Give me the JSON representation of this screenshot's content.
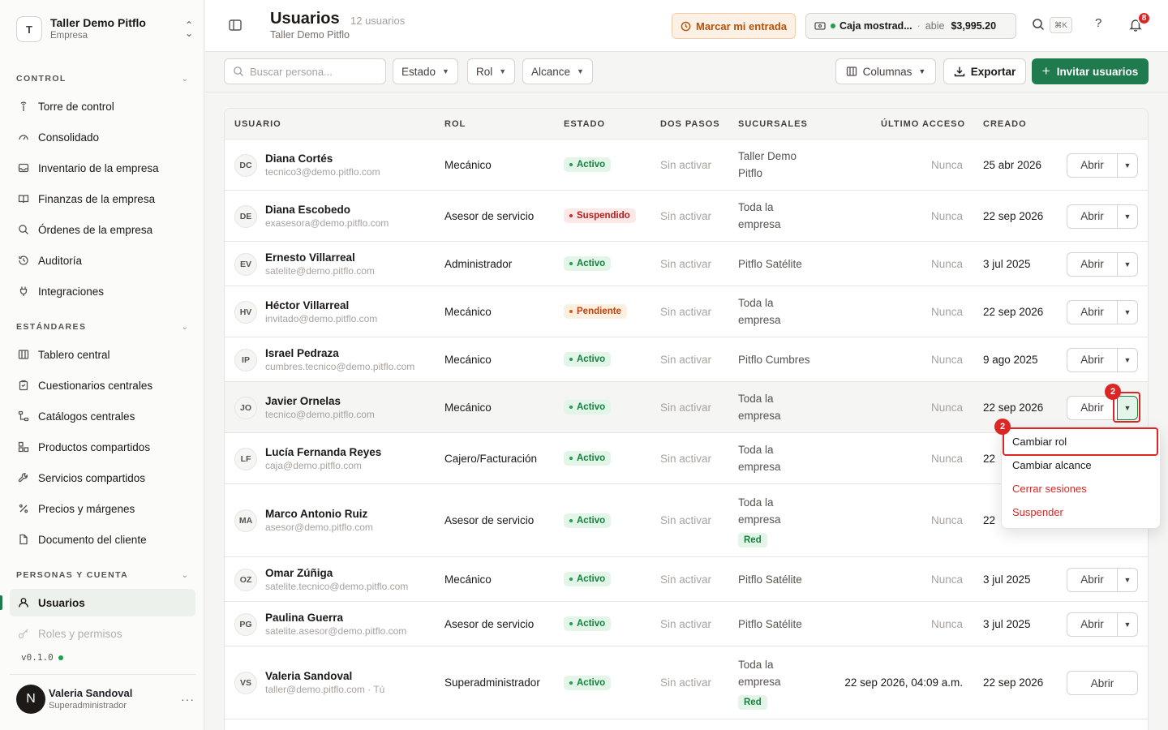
{
  "company": {
    "initial": "T",
    "name": "Taller Demo Pitflo",
    "type": "Empresa"
  },
  "sidebar": {
    "sections": [
      {
        "title": "CONTROL",
        "items": [
          {
            "label": "Torre de control",
            "icon": "tower-icon"
          },
          {
            "label": "Consolidado",
            "icon": "gauge-icon"
          },
          {
            "label": "Inventario de la empresa",
            "icon": "inbox-icon"
          },
          {
            "label": "Finanzas de la empresa",
            "icon": "book-icon"
          },
          {
            "label": "Órdenes de la empresa",
            "icon": "search-icon"
          },
          {
            "label": "Auditoría",
            "icon": "history-icon"
          },
          {
            "label": "Integraciones",
            "icon": "plug-icon"
          }
        ]
      },
      {
        "title": "ESTÁNDARES",
        "items": [
          {
            "label": "Tablero central",
            "icon": "columns-icon"
          },
          {
            "label": "Cuestionarios centrales",
            "icon": "clipboard-icon"
          },
          {
            "label": "Catálogos centrales",
            "icon": "tree-icon"
          },
          {
            "label": "Productos compartidos",
            "icon": "boxes-icon"
          },
          {
            "label": "Servicios compartidos",
            "icon": "wrench-icon"
          },
          {
            "label": "Precios y márgenes",
            "icon": "percent-icon"
          },
          {
            "label": "Documento del cliente",
            "icon": "document-icon"
          }
        ]
      },
      {
        "title": "PERSONAS Y CUENTA",
        "items": [
          {
            "label": "Usuarios",
            "icon": "user-icon"
          },
          {
            "label": "Roles y permisos",
            "icon": "key-icon"
          }
        ]
      }
    ],
    "version": "v0.1.0",
    "user": {
      "initial": "N",
      "name": "Valeria Sandoval",
      "role": "Superadministrador"
    }
  },
  "header": {
    "title": "Usuarios",
    "count": "12 usuarios",
    "breadcrumb": "Taller Demo Pitflo",
    "checkin_label": "Marcar mi entrada",
    "cash": {
      "name": "Caja mostrad...",
      "status": "abie",
      "amount": "$3,995.20"
    },
    "shortcut": "⌘K",
    "help": "?",
    "notifications": "8"
  },
  "toolbar": {
    "search_placeholder": "Buscar persona...",
    "filters": [
      "Estado",
      "Rol",
      "Alcance"
    ],
    "columns_label": "Columnas",
    "export_label": "Exportar",
    "invite_label": "Invitar usuarios"
  },
  "table": {
    "headers": [
      "USUARIO",
      "ROL",
      "ESTADO",
      "DOS PASOS",
      "SUCURSALES",
      "ÚLTIMO ACCESO",
      "CREADO"
    ],
    "open_label": "Abrir",
    "rows": [
      {
        "initials": "DC",
        "name": "Diana Cortés",
        "email": "tecnico3@demo.pitflo.com",
        "role": "Mecánico",
        "status": "Activo",
        "status_kind": "activo",
        "two_step": "Sin activar",
        "branch": [
          "Taller Demo",
          "Pitflo"
        ],
        "last": "Nunca",
        "created": "25 abr 2026"
      },
      {
        "initials": "DE",
        "name": "Diana Escobedo",
        "email": "exasesora@demo.pitflo.com",
        "role": "Asesor de servicio",
        "status": "Suspendido",
        "status_kind": "susp",
        "two_step": "Sin activar",
        "branch": [
          "Toda la",
          "empresa"
        ],
        "last": "Nunca",
        "created": "22 sep 2026"
      },
      {
        "initials": "EV",
        "name": "Ernesto Villarreal",
        "email": "satelite@demo.pitflo.com",
        "role": "Administrador",
        "status": "Activo",
        "status_kind": "activo",
        "two_step": "Sin activar",
        "branch": [
          "Pitflo Satélite"
        ],
        "last": "Nunca",
        "created": "3 jul 2025"
      },
      {
        "initials": "HV",
        "name": "Héctor Villarreal",
        "email": "invitado@demo.pitflo.com",
        "role": "Mecánico",
        "status": "Pendiente",
        "status_kind": "pend",
        "two_step": "Sin activar",
        "branch": [
          "Toda la",
          "empresa"
        ],
        "last": "Nunca",
        "created": "22 sep 2026"
      },
      {
        "initials": "IP",
        "name": "Israel Pedraza",
        "email": "cumbres.tecnico@demo.pitflo.com",
        "role": "Mecánico",
        "status": "Activo",
        "status_kind": "activo",
        "two_step": "Sin activar",
        "branch": [
          "Pitflo Cumbres"
        ],
        "last": "Nunca",
        "created": "9 ago 2025"
      },
      {
        "initials": "JO",
        "name": "Javier Ornelas",
        "email": "tecnico@demo.pitflo.com",
        "role": "Mecánico",
        "status": "Activo",
        "status_kind": "activo",
        "two_step": "Sin activar",
        "branch": [
          "Toda la",
          "empresa"
        ],
        "last": "Nunca",
        "created": "22 sep 2026"
      },
      {
        "initials": "LF",
        "name": "Lucía Fernanda Reyes",
        "email": "caja@demo.pitflo.com",
        "role": "Cajero/Facturación",
        "status": "Activo",
        "status_kind": "activo",
        "two_step": "Sin activar",
        "branch": [
          "Toda la",
          "empresa"
        ],
        "last": "Nunca",
        "created": "22"
      },
      {
        "initials": "MA",
        "name": "Marco Antonio Ruiz",
        "email": "asesor@demo.pitflo.com",
        "role": "Asesor de servicio",
        "status": "Activo",
        "status_kind": "activo",
        "two_step": "Sin activar",
        "branch": [
          "Toda la",
          "empresa"
        ],
        "tag": "Red",
        "last": "Nunca",
        "created": "22"
      },
      {
        "initials": "OZ",
        "name": "Omar Zúñiga",
        "email": "satelite.tecnico@demo.pitflo.com",
        "role": "Mecánico",
        "status": "Activo",
        "status_kind": "activo",
        "two_step": "Sin activar",
        "branch": [
          "Pitflo Satélite"
        ],
        "last": "Nunca",
        "created": "3 jul 2025"
      },
      {
        "initials": "PG",
        "name": "Paulina Guerra",
        "email": "satelite.asesor@demo.pitflo.com",
        "role": "Asesor de servicio",
        "status": "Activo",
        "status_kind": "activo",
        "two_step": "Sin activar",
        "branch": [
          "Pitflo Satélite"
        ],
        "last": "Nunca",
        "created": "3 jul 2025"
      },
      {
        "initials": "VS",
        "name": "Valeria Sandoval",
        "email": "taller@demo.pitflo.com · Tú",
        "role": "Superadministrador",
        "status": "Activo",
        "status_kind": "activo",
        "two_step": "Sin activar",
        "branch": [
          "Toda la",
          "empresa"
        ],
        "tag": "Red",
        "last": "22 sep 2026, 04:09 a.m.",
        "created": "22 sep 2026"
      }
    ]
  },
  "dropdown": {
    "items": [
      {
        "label": "Cambiar rol",
        "danger": false
      },
      {
        "label": "Cambiar alcance",
        "danger": false
      },
      {
        "label": "Cerrar sesiones",
        "danger": true
      },
      {
        "label": "Suspender",
        "danger": true
      }
    ]
  },
  "markers": [
    "2",
    "2"
  ],
  "colors": {
    "accent": "#1f7a4d",
    "danger": "#dc2626",
    "warning": "#b45309"
  }
}
